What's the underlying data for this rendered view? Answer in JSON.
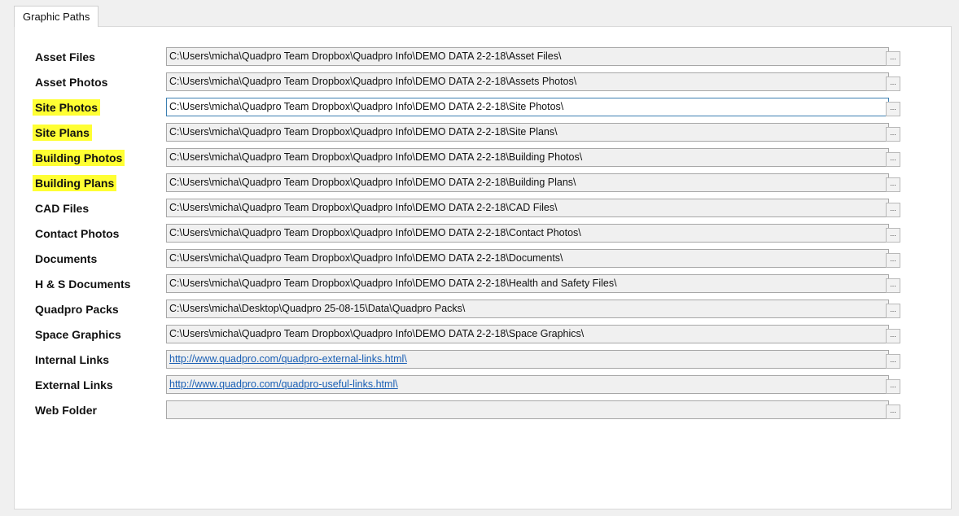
{
  "tab": {
    "label": "Graphic Paths"
  },
  "rows": [
    {
      "label": "Asset Files",
      "value": "C:\\Users\\micha\\Quadpro Team Dropbox\\Quadpro Info\\DEMO DATA 2-2-18\\Asset Files\\"
    },
    {
      "label": "Asset Photos",
      "value": "C:\\Users\\micha\\Quadpro Team Dropbox\\Quadpro Info\\DEMO DATA 2-2-18\\Assets Photos\\"
    },
    {
      "label": "Site Photos",
      "value": "C:\\Users\\micha\\Quadpro Team Dropbox\\Quadpro Info\\DEMO DATA 2-2-18\\Site Photos\\"
    },
    {
      "label": "Site Plans",
      "value": "C:\\Users\\micha\\Quadpro Team Dropbox\\Quadpro Info\\DEMO DATA 2-2-18\\Site Plans\\"
    },
    {
      "label": "Building Photos",
      "value": "C:\\Users\\micha\\Quadpro Team Dropbox\\Quadpro Info\\DEMO DATA 2-2-18\\Building Photos\\"
    },
    {
      "label": "Building Plans",
      "value": "C:\\Users\\micha\\Quadpro Team Dropbox\\Quadpro Info\\DEMO DATA 2-2-18\\Building Plans\\"
    },
    {
      "label": "CAD Files",
      "value": "C:\\Users\\micha\\Quadpro Team Dropbox\\Quadpro Info\\DEMO DATA 2-2-18\\CAD Files\\"
    },
    {
      "label": "Contact Photos",
      "value": "C:\\Users\\micha\\Quadpro Team Dropbox\\Quadpro Info\\DEMO DATA 2-2-18\\Contact Photos\\"
    },
    {
      "label": "Documents",
      "value": "C:\\Users\\micha\\Quadpro Team Dropbox\\Quadpro Info\\DEMO DATA 2-2-18\\Documents\\"
    },
    {
      "label": "H & S Documents",
      "value": "C:\\Users\\micha\\Quadpro Team Dropbox\\Quadpro Info\\DEMO DATA 2-2-18\\Health and Safety Files\\"
    },
    {
      "label": "Quadpro Packs",
      "value": "C:\\Users\\micha\\Desktop\\Quadpro 25-08-15\\Data\\Quadpro Packs\\"
    },
    {
      "label": "Space Graphics",
      "value": "C:\\Users\\micha\\Quadpro Team Dropbox\\Quadpro Info\\DEMO DATA 2-2-18\\Space Graphics\\"
    },
    {
      "label": "Internal Links",
      "value": "http://www.quadpro.com/quadpro-external-links.html\\"
    },
    {
      "label": "External Links",
      "value": "http://www.quadpro.com/quadpro-useful-links.html\\"
    },
    {
      "label": "Web Folder",
      "value": ""
    }
  ],
  "browse_label": "...",
  "colors": {
    "highlight": "#ffff33",
    "link": "#1a5fb4",
    "focus_border": "#3c7fb1"
  }
}
